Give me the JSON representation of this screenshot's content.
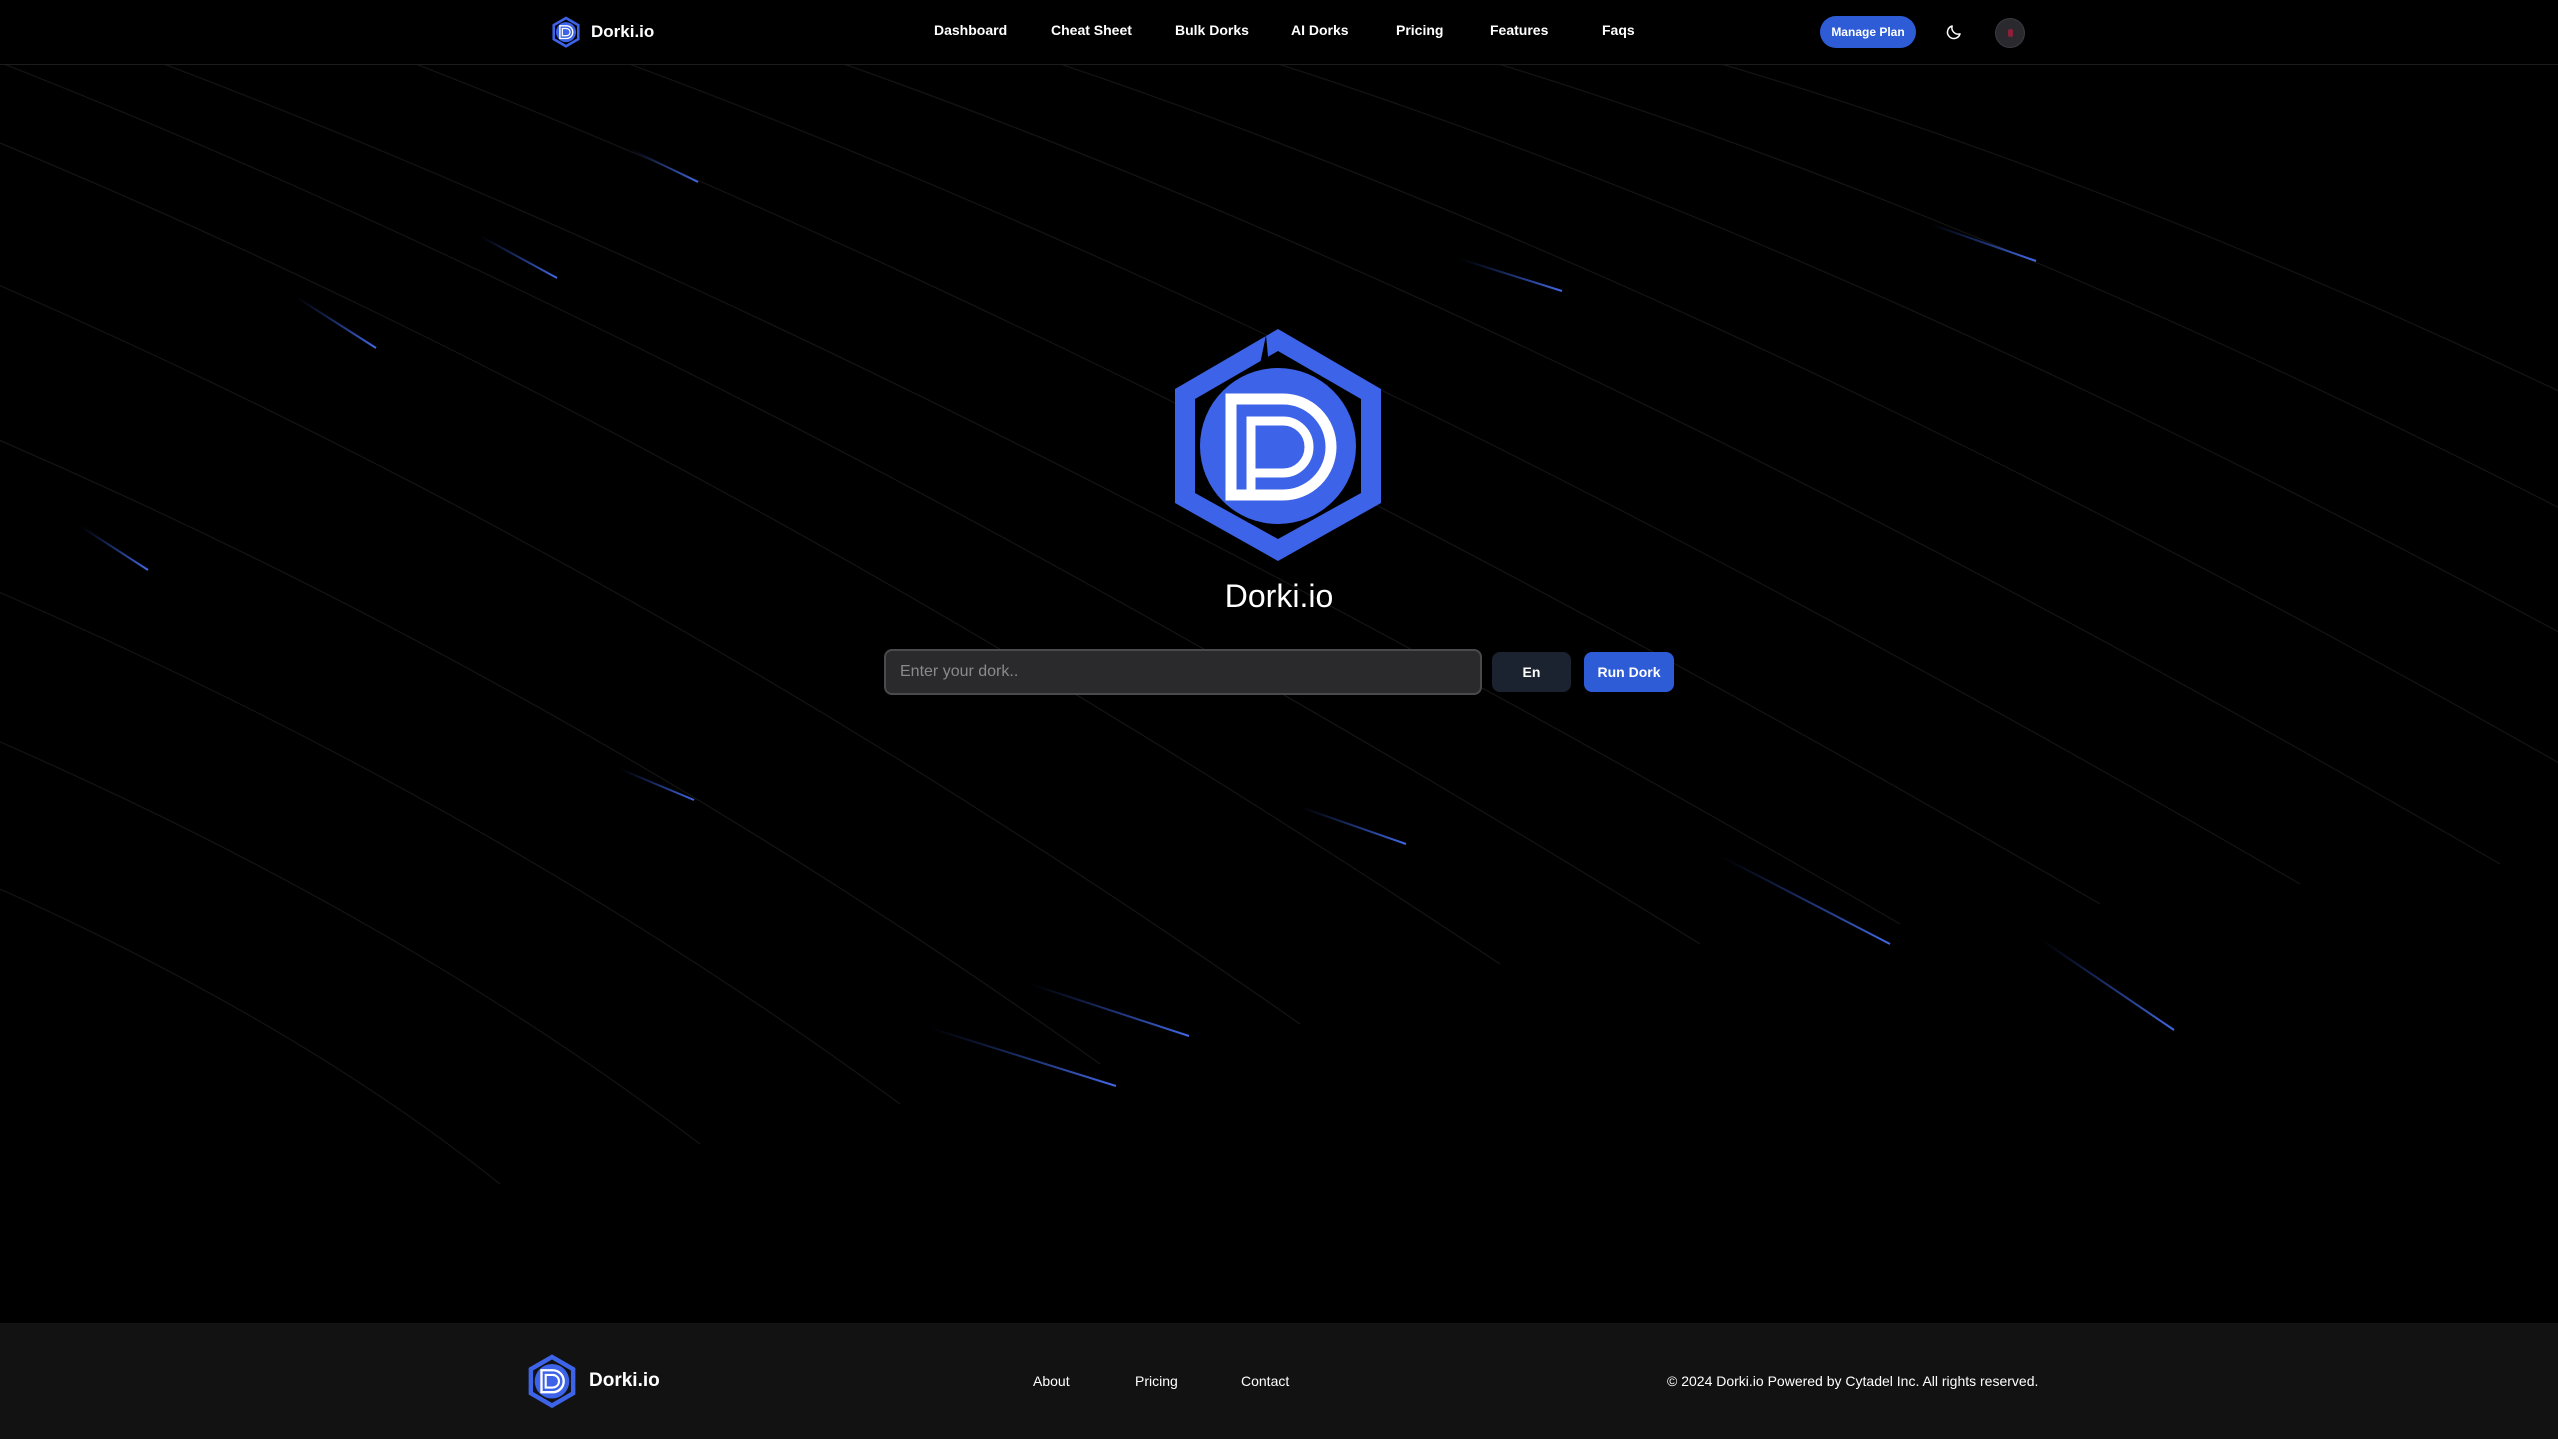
{
  "header": {
    "brand_name": "Dorki.io",
    "nav": [
      {
        "label": "Dashboard"
      },
      {
        "label": "Cheat Sheet"
      },
      {
        "label": "Bulk Dorks"
      },
      {
        "label": "AI Dorks"
      },
      {
        "label": "Pricing"
      },
      {
        "label": "Features"
      },
      {
        "label": "Faqs"
      }
    ],
    "manage_plan_label": "Manage Plan",
    "theme_icon": "moon-icon",
    "avatar_icon": "user-avatar"
  },
  "hero": {
    "logo_icon": "dorki-hexagon-logo",
    "title": "Dorki.io",
    "search_placeholder": "Enter your dork..",
    "search_value": "",
    "lang_label": "En",
    "run_label": "Run Dork"
  },
  "footer": {
    "brand_name": "Dorki.io",
    "links": [
      {
        "label": "About"
      },
      {
        "label": "Pricing"
      },
      {
        "label": "Contact"
      }
    ],
    "copyright": "© 2024 Dorki.io Powered by Cytadel Inc. All rights reserved."
  },
  "colors": {
    "accent": "#2e5bd6",
    "logo_blue": "#3d63e8",
    "background": "#000000",
    "footer_bg": "#121212"
  }
}
